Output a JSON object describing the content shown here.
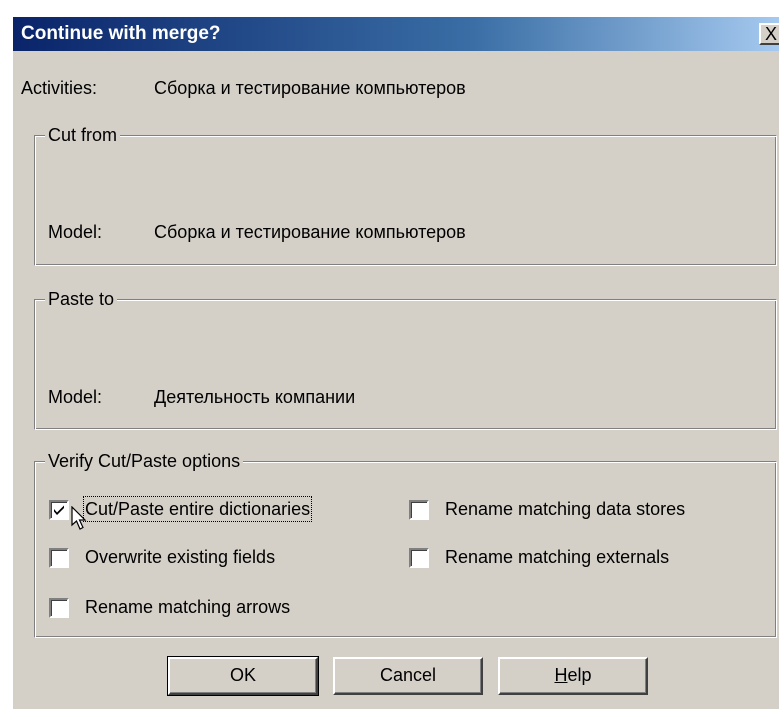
{
  "dialog": {
    "title": "Continue with merge?",
    "close_glyph": "X",
    "activities_label": "Activities:",
    "activities_value": "Сборка и  тестирование  компьютеров"
  },
  "cut_from": {
    "legend": "Cut from",
    "model_label": "Model:",
    "model_value": "Сборка и тестирование компьютеров"
  },
  "paste_to": {
    "legend": "Paste to",
    "model_label": "Model:",
    "model_value": "Деятельность компании"
  },
  "options": {
    "legend": "Verify Cut/Paste options",
    "items": [
      {
        "label": "Cut/Paste entire dictionaries",
        "checked": true
      },
      {
        "label": "Overwrite existing fields",
        "checked": false
      },
      {
        "label": "Rename matching arrows",
        "checked": false
      },
      {
        "label": "Rename matching data stores",
        "checked": false
      },
      {
        "label": "Rename matching externals",
        "checked": false
      }
    ]
  },
  "buttons": {
    "ok": "OK",
    "cancel": "Cancel",
    "help_mnemonic": "H",
    "help_rest": "elp"
  },
  "icons": [
    "close-icon",
    "checkmark-icon",
    "mouse-pointer-icon"
  ]
}
